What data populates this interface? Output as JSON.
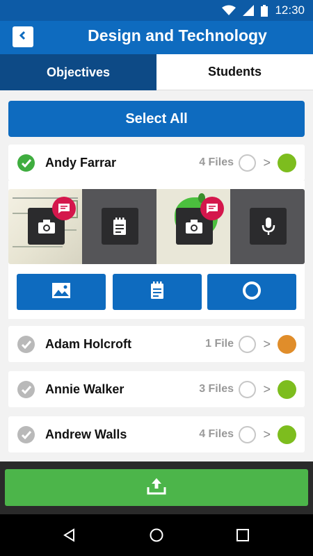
{
  "status_bar": {
    "time": "12:30",
    "icons": [
      "wifi-icon",
      "signal-icon",
      "battery-icon"
    ]
  },
  "app_bar": {
    "title": "Design and Technology",
    "back_icon": "chevron-left-icon"
  },
  "tabs": [
    {
      "label": "Objectives",
      "active": true
    },
    {
      "label": "Students",
      "active": false
    }
  ],
  "select_all_label": "Select All",
  "students": [
    {
      "name": "Andy Farrar",
      "files": "4 Files",
      "selected": true,
      "status_color": "#7dbd1e",
      "chevron": ">"
    },
    {
      "name": "Adam Holcroft",
      "files": "1 File",
      "selected": false,
      "status_color": "#e08d2a",
      "chevron": ">"
    },
    {
      "name": "Annie Walker",
      "files": "3 Files",
      "selected": false,
      "status_color": "#7dbd1e",
      "chevron": ">"
    },
    {
      "name": "Andrew Walls",
      "files": "4 Files",
      "selected": false,
      "status_color": "#7dbd1e",
      "chevron": ">"
    }
  ],
  "media_items": [
    {
      "type": "photo",
      "thumbnail": "sketch",
      "icon": "camera-icon",
      "has_comment": true
    },
    {
      "type": "note",
      "icon": "note-icon",
      "has_comment": false
    },
    {
      "type": "photo",
      "thumbnail": "apple",
      "icon": "camera-icon",
      "has_comment": true
    },
    {
      "type": "audio",
      "icon": "microphone-icon",
      "has_comment": false
    }
  ],
  "actions": [
    {
      "name": "add-image",
      "icon": "image-icon"
    },
    {
      "name": "add-note",
      "icon": "note-icon"
    },
    {
      "name": "record",
      "icon": "record-ring-icon"
    }
  ],
  "upload_icon": "upload-icon",
  "nav": [
    "back-triangle-icon",
    "home-circle-icon",
    "recents-square-icon"
  ],
  "colors": {
    "primary": "#0e6bbf",
    "tab_active": "#0d4a86",
    "upload_green": "#4cb54a",
    "selected_check": "#3fad3f",
    "comment_badge": "#d4174c"
  }
}
